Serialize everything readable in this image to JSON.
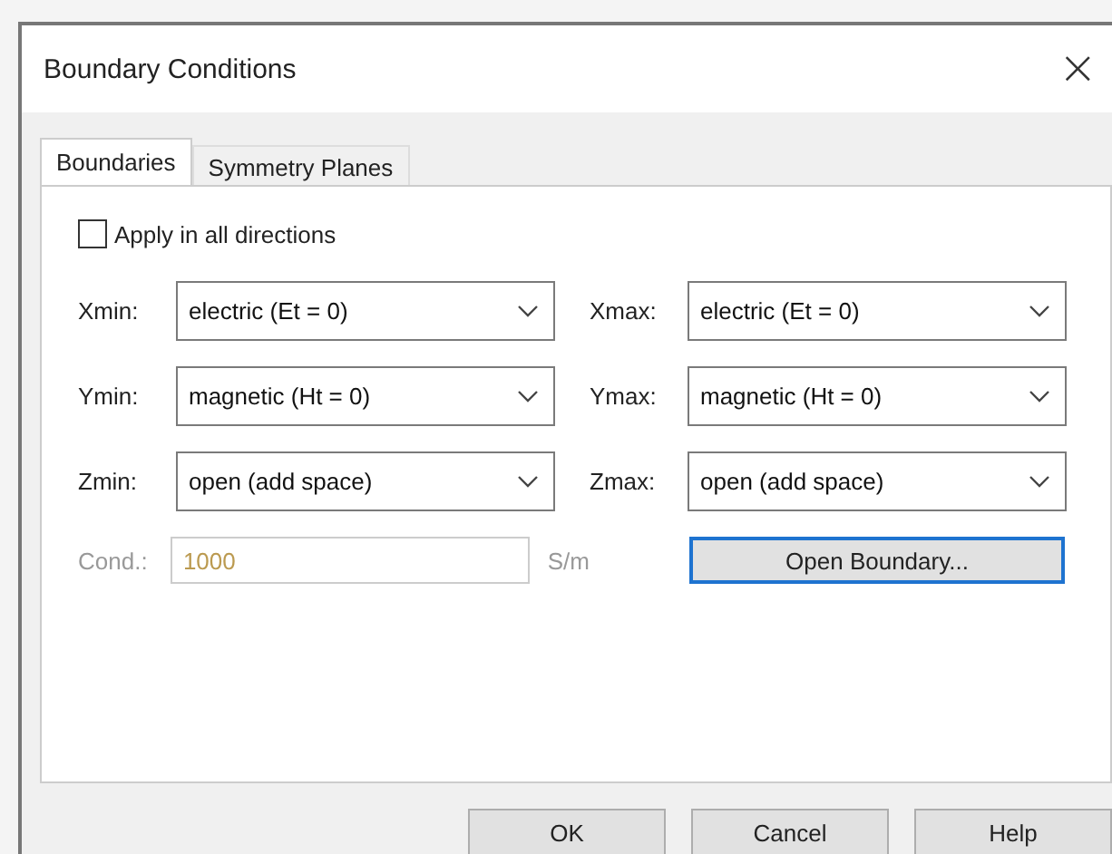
{
  "window": {
    "title": "Boundary Conditions",
    "close": "×"
  },
  "tabs": [
    {
      "label": "Boundaries",
      "selected": true
    },
    {
      "label": "Symmetry Planes",
      "selected": false
    }
  ],
  "apply_all": {
    "label": "Apply in all directions",
    "checked": false
  },
  "boundaries": [
    {
      "label": "Xmin:",
      "value": "electric (Et = 0)"
    },
    {
      "label": "Xmax:",
      "value": "electric (Et = 0)"
    },
    {
      "label": "Ymin:",
      "value": "magnetic (Ht = 0)"
    },
    {
      "label": "Ymax:",
      "value": "magnetic (Ht = 0)"
    },
    {
      "label": "Zmin:",
      "value": "open (add space)"
    },
    {
      "label": "Zmax:",
      "value": "open (add space)"
    }
  ],
  "conductivity": {
    "label": "Cond.:",
    "value": "1000",
    "unit": "S/m",
    "disabled": true
  },
  "open_boundary_button": "Open Boundary...",
  "buttons": [
    "OK",
    "Cancel",
    "Help"
  ]
}
